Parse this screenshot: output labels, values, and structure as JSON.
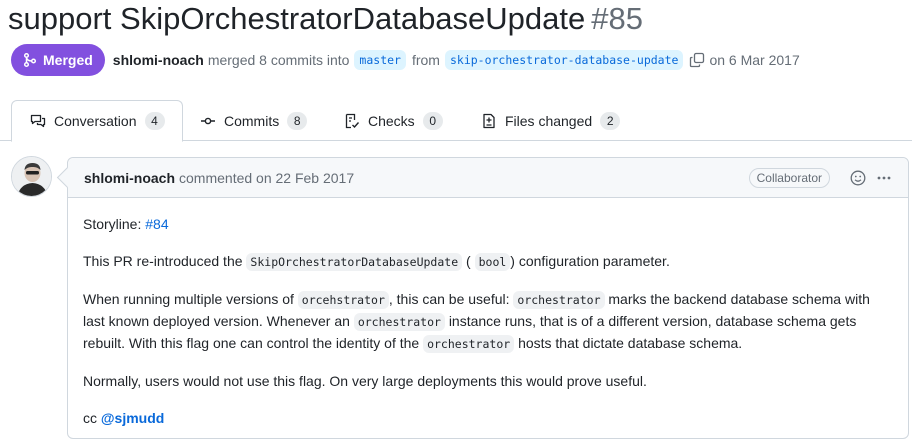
{
  "pr": {
    "title": "support SkipOrchestratorDatabaseUpdate",
    "number": "#85",
    "state": "Merged",
    "author": "shlomi-noach",
    "merged_text": "merged 8 commits into",
    "base_branch": "master",
    "from_text": "from",
    "head_branch": "skip-orchestrator-database-update",
    "date_text": "on 6 Mar 2017"
  },
  "tabs": [
    {
      "label": "Conversation",
      "count": "4",
      "icon": "comment-discussion-icon",
      "selected": true
    },
    {
      "label": "Commits",
      "count": "8",
      "icon": "git-commit-icon",
      "selected": false
    },
    {
      "label": "Checks",
      "count": "0",
      "icon": "checklist-icon",
      "selected": false
    },
    {
      "label": "Files changed",
      "count": "2",
      "icon": "file-diff-icon",
      "selected": false
    }
  ],
  "comment": {
    "author": "shlomi-noach",
    "action": "commented on 22 Feb 2017",
    "role": "Collaborator",
    "storyline_label": "Storyline:",
    "storyline_link": "#84",
    "p1_a": "This PR re-introduced the",
    "p1_code1": "SkipOrchestratorDatabaseUpdate",
    "p1_paren_open": "(",
    "p1_code2": "bool",
    "p1_b": ") configuration parameter.",
    "p2_a": "When running multiple versions of",
    "p2_code1": "orcehstrator",
    "p2_b": ", this can be useful:",
    "p2_code2": "orchestrator",
    "p2_c": "marks the backend database schema with last known deployed version. Whenever an",
    "p2_code3": "orchestrator",
    "p2_d": "instance runs, that is of a different version, database schema gets rebuilt. With this flag one can control the identity of the",
    "p2_code4": "orchestrator",
    "p2_e": "hosts that dictate database schema.",
    "p3": "Normally, users would not use this flag. On very large deployments this would prove useful.",
    "cc_text": "cc",
    "cc_mention": "@sjmudd"
  },
  "colors": {
    "merged": "#8250df",
    "link": "#0969da",
    "border": "#d0d7de",
    "muted": "#656d76"
  }
}
